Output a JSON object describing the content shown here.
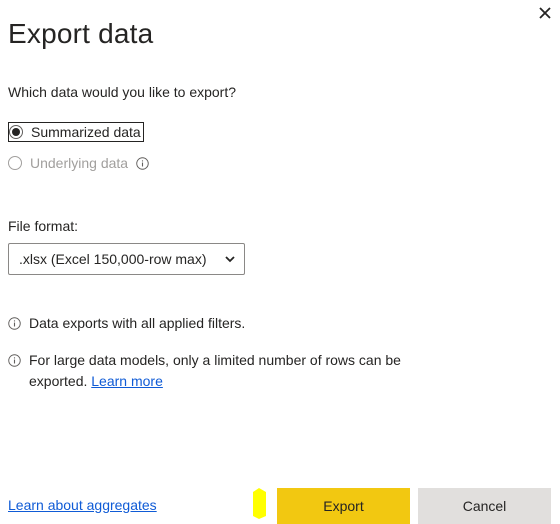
{
  "dialog": {
    "title": "Export data",
    "close_icon": "close-icon"
  },
  "question": "Which data would you like to export?",
  "options": {
    "summarized": {
      "label": "Summarized data",
      "selected": true
    },
    "underlying": {
      "label": "Underlying data",
      "enabled": false,
      "info_icon": "info-icon"
    }
  },
  "file_format": {
    "label": "File format:",
    "selected": ".xlsx (Excel 150,000-row max)"
  },
  "notes": {
    "filters": "Data exports with all applied filters.",
    "large_models": "For large data models, only a limited number of rows can be exported.",
    "learn_more": "Learn more"
  },
  "footer": {
    "learn_aggregates": "Learn about aggregates",
    "export_label": "Export",
    "cancel_label": "Cancel"
  },
  "colors": {
    "export_button": "#f2c811",
    "cancel_button": "#e1dfdd",
    "link": "#0f5bd6"
  }
}
